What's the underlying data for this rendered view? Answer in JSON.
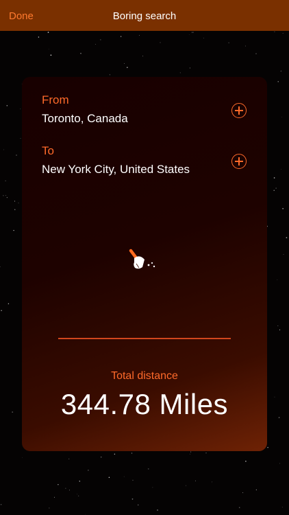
{
  "navbar": {
    "done_label": "Done",
    "title": "Boring search"
  },
  "route": {
    "from_label": "From",
    "from_value": "Toronto, Canada",
    "to_label": "To",
    "to_value": "New York City, United States"
  },
  "total": {
    "label": "Total distance",
    "value": "344.78 Miles"
  },
  "icons": {
    "from_add": "plus-circle-icon",
    "to_add": "plus-circle-icon",
    "center": "broom-icon"
  },
  "colors": {
    "navbar_bg": "#7a3000",
    "accent": "#ff6a2a",
    "card_gradient_start": "#180000",
    "card_gradient_end": "#6e2205",
    "background": "#050303"
  }
}
